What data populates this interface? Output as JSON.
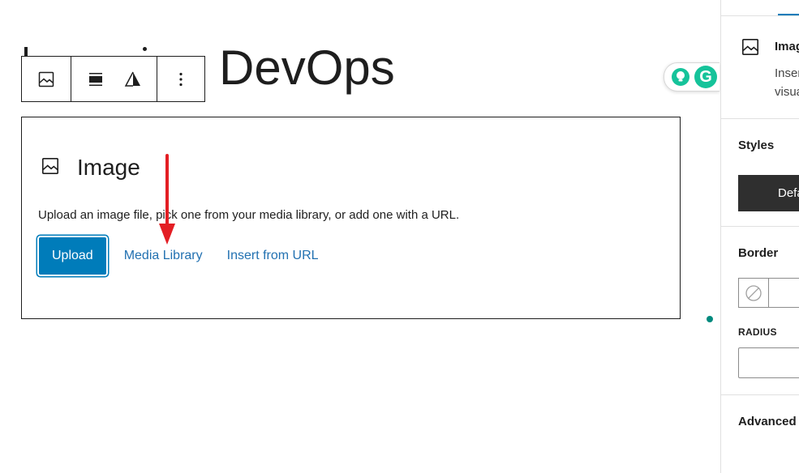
{
  "editor": {
    "post_title": "DevOps"
  },
  "toolbar": {
    "buttons": [
      "image-block-icon",
      "align-icon",
      "duotone-icon",
      "more-options-icon"
    ]
  },
  "image_placeholder": {
    "title": "Image",
    "instructions": "Upload an image file, pick one from your media library, or add one with a URL.",
    "upload_label": "Upload",
    "media_library_label": "Media Library",
    "insert_url_label": "Insert from URL"
  },
  "grammarly": {
    "logo_letter": "G"
  },
  "sidebar": {
    "block_card": {
      "title": "Imag",
      "description": "Insert an image to make a visual statement."
    },
    "styles_heading": "Styles",
    "style_default_label": "Default",
    "border_heading": "Border",
    "radius_label": "RADIUS",
    "advanced_heading": "Advanced"
  },
  "colors": {
    "accent": "#007cba",
    "link": "#2271b1",
    "annotation_arrow": "#e31e24",
    "grammarly": "#15c39a"
  }
}
